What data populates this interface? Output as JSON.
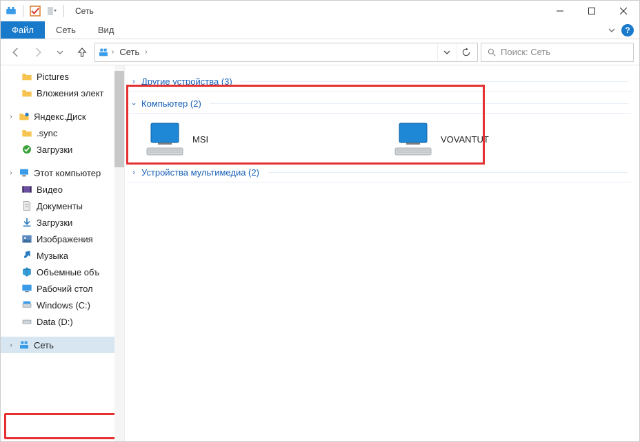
{
  "title": "Сеть",
  "ribbon": {
    "file": "Файл",
    "tabs": [
      "Сеть",
      "Вид"
    ]
  },
  "breadcrumb": {
    "segment": "Сеть"
  },
  "search": {
    "placeholder": "Поиск: Сеть"
  },
  "sidebar": {
    "items_a": [
      {
        "label": "Pictures",
        "icon": "folder"
      },
      {
        "label": "Вложения элект",
        "icon": "folder"
      }
    ],
    "yandex": {
      "label": "Яндекс.Диск",
      "icon": "yandex"
    },
    "items_b": [
      {
        "label": ".sync",
        "icon": "folder"
      },
      {
        "label": "Загрузки",
        "icon": "check"
      }
    ],
    "thispc": {
      "label": "Этот компьютер",
      "icon": "pc"
    },
    "items_c": [
      {
        "label": "Видео",
        "icon": "video"
      },
      {
        "label": "Документы",
        "icon": "doc"
      },
      {
        "label": "Загрузки",
        "icon": "down"
      },
      {
        "label": "Изображения",
        "icon": "img"
      },
      {
        "label": "Музыка",
        "icon": "music"
      },
      {
        "label": "Объемные объ",
        "icon": "3d"
      },
      {
        "label": "Рабочий стол",
        "icon": "desktop"
      },
      {
        "label": "Windows (C:)",
        "icon": "drive"
      },
      {
        "label": "Data (D:)",
        "icon": "drive"
      }
    ],
    "network": {
      "label": "Сеть",
      "icon": "network"
    }
  },
  "content": {
    "group_other": "Другие устройства (3)",
    "group_computer": "Компьютер (2)",
    "computers": [
      {
        "name": "MSI"
      },
      {
        "name": "VOVANTUT"
      }
    ],
    "group_multimedia": "Устройства мультимедиа (2)"
  }
}
